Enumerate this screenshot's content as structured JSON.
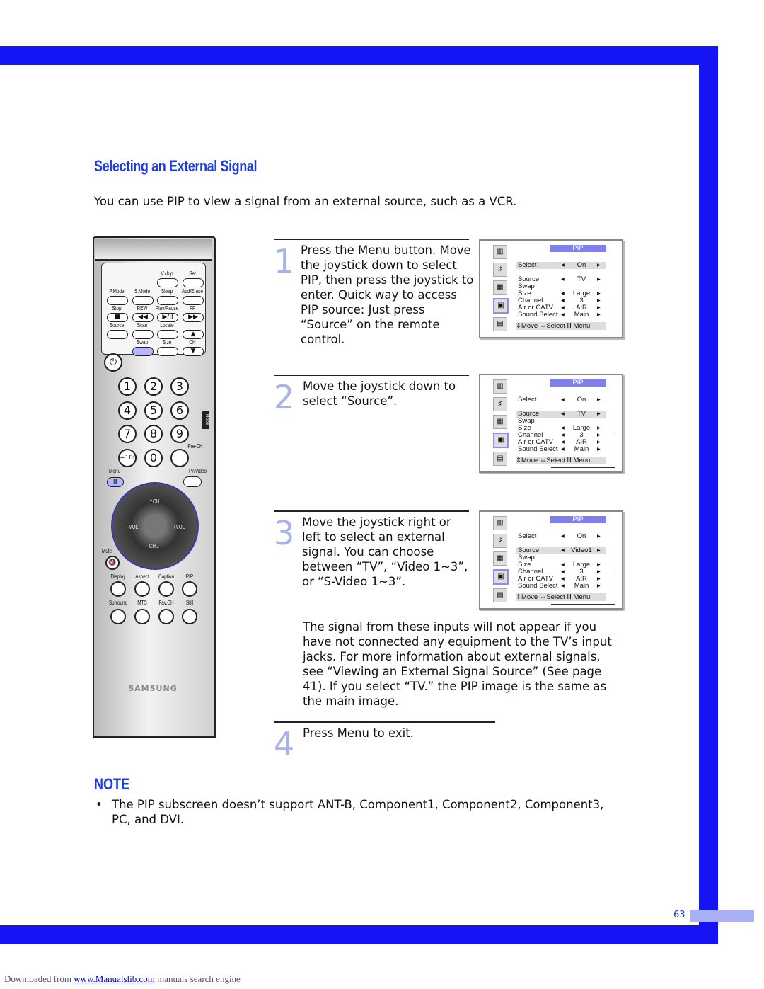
{
  "title": "Selecting an External Signal",
  "intro": "You can use PIP to view a signal from an external source, such as a VCR.",
  "steps": [
    {
      "number": "1",
      "text": "Press the Menu button. Move the joystick down to select PIP, then press the joystick to enter. Quick way to access PIP source:  Just press “Source” on the remote control."
    },
    {
      "number": "2",
      "text": "Move the joystick down to select “Source”."
    },
    {
      "number": "3",
      "text": "Move the joystick right or left to select an external signal. You can choose between “TV”, “Video 1~3”, or “S-Video 1~3”."
    },
    {
      "number": "4",
      "text": "Press Menu to exit."
    }
  ],
  "step3_note": "The signal from these inputs will not appear if you have not connected any equipment to the TV’s input jacks. For more information about external signals, see “Viewing an External Signal Source” (See page 41).  If you select “TV.” the PIP image is the same as the main image.",
  "menus": [
    {
      "header": "PIP",
      "highlight": "Select",
      "rows": [
        [
          "Select",
          "On"
        ],
        [
          "Source",
          "TV"
        ],
        [
          "Swap",
          ""
        ],
        [
          "Size",
          "Large"
        ],
        [
          "Channel",
          "3"
        ],
        [
          "Air or CATV",
          "AIR"
        ],
        [
          "Sound Select",
          "Main"
        ]
      ],
      "footer": "⇕Move  ⇔Select  Ⅲ Menu"
    },
    {
      "header": "PIP",
      "highlight": "Source",
      "rows": [
        [
          "Select",
          "On"
        ],
        [
          "Source",
          "TV"
        ],
        [
          "Swap",
          ""
        ],
        [
          "Size",
          "Large"
        ],
        [
          "Channel",
          "3"
        ],
        [
          "Air or CATV",
          "AIR"
        ],
        [
          "Sound Select",
          "Main"
        ]
      ],
      "footer": "⇕Move  ⇔Select  Ⅲ Menu"
    },
    {
      "header": "PIP",
      "highlight": "Source",
      "rows": [
        [
          "Select",
          "On"
        ],
        [
          "Source",
          "Video1"
        ],
        [
          "Swap",
          ""
        ],
        [
          "Size",
          "Large"
        ],
        [
          "Channel",
          "3"
        ],
        [
          "Air or CATV",
          "AIR"
        ],
        [
          "Sound Select",
          "Main"
        ]
      ],
      "footer": "⇕Move  ⇔Select  Ⅲ Menu"
    }
  ],
  "note": {
    "heading": "NOTE",
    "items": [
      "The PIP subscreen doesn’t support ANT-B, Component1, Component2, Component3, PC, and DVI."
    ]
  },
  "page_number": "63",
  "footer": {
    "prefix": "Downloaded from ",
    "link": "www.Manualslib.com",
    "suffix": " manuals search engine"
  },
  "remote": {
    "brand": "SAMSUNG",
    "mode": "MODE",
    "top_buttons": [
      {
        "label": "V.chip"
      },
      {
        "label": "Set"
      },
      {
        "label": "P.Mode"
      },
      {
        "label": "S.Mode"
      },
      {
        "label": "Sleep"
      },
      {
        "label": "Add/Erase"
      },
      {
        "label": "Stop",
        "glyph": "■"
      },
      {
        "label": "REW",
        "glyph": "◀◀"
      },
      {
        "label": "Play/Pause",
        "glyph": "▶/II"
      },
      {
        "label": "FF",
        "glyph": "▶▶"
      },
      {
        "label": "Source"
      },
      {
        "label": "Scan"
      },
      {
        "label": "Locate"
      },
      {
        "label": "",
        "glyph": "▲"
      },
      {
        "label": "Swap",
        "active": true
      },
      {
        "label": "Size"
      },
      {
        "label": "CH",
        "glyph": "▼"
      }
    ],
    "numbers": [
      "1",
      "2",
      "3",
      "4",
      "5",
      "6",
      "7",
      "8",
      "9",
      "+100",
      "0",
      ""
    ],
    "prech": "Pre-CH",
    "menu": "Menu",
    "tvvideo": "TV/Video",
    "ch": "CH",
    "vol": "VOL",
    "mute": "Mute",
    "bottom_labels": [
      "Display",
      "Aspect",
      "Caption",
      "PIP",
      "Surround",
      "MTS",
      "Fav.CH",
      "Still"
    ]
  },
  "colors": {
    "frame": "#1414f5",
    "title": "#1e3ce6",
    "step_number": "#a9b2e4",
    "accent_light": "#8b8cf5"
  }
}
